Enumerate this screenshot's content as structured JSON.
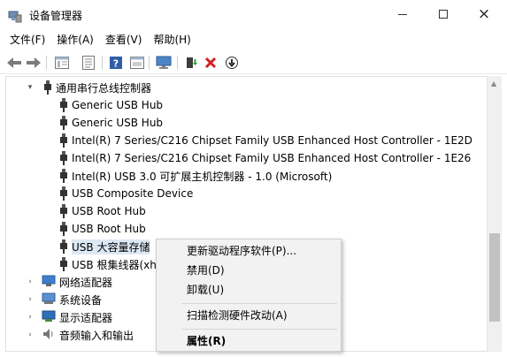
{
  "window": {
    "title": "设备管理器",
    "controls": {
      "minimize": "minimize",
      "maximize": "maximize",
      "close": "×"
    }
  },
  "menubar": {
    "items": [
      {
        "label": "文件(F)"
      },
      {
        "label": "操作(A)"
      },
      {
        "label": "查看(V)"
      },
      {
        "label": "帮助(H)"
      }
    ]
  },
  "toolbar": {
    "icons": [
      "back-icon",
      "forward-icon",
      "properties-icon",
      "list-icon",
      "help-icon",
      "view-icon",
      "monitor-icon",
      "update-driver-icon",
      "uninstall-icon",
      "scan-icon"
    ]
  },
  "tree": {
    "category_usb": "通用串行总线控制器",
    "usb_devices": [
      "Generic USB Hub",
      "Generic USB Hub",
      "Intel(R) 7 Series/C216 Chipset Family USB Enhanced Host Controller - 1E2D",
      "Intel(R) 7 Series/C216 Chipset Family USB Enhanced Host Controller - 1E26",
      "Intel(R) USB 3.0 可扩展主机控制器 - 1.0 (Microsoft)",
      "USB Composite Device",
      "USB Root Hub",
      "USB Root Hub",
      "USB 大容量存储",
      "USB 根集线器(xh"
    ],
    "other_categories": [
      "网络适配器",
      "系统设备",
      "显示适配器",
      "音频输入和输出"
    ]
  },
  "context_menu": {
    "items": [
      "更新驱动程序软件(P)...",
      "禁用(D)",
      "卸载(U)",
      "扫描检测硬件改动(A)",
      "属性(R)"
    ]
  },
  "colors": {
    "selection": "#dde8f5",
    "context_bg": "#f2f2f2",
    "uninstall_red": "#d21f1f"
  }
}
